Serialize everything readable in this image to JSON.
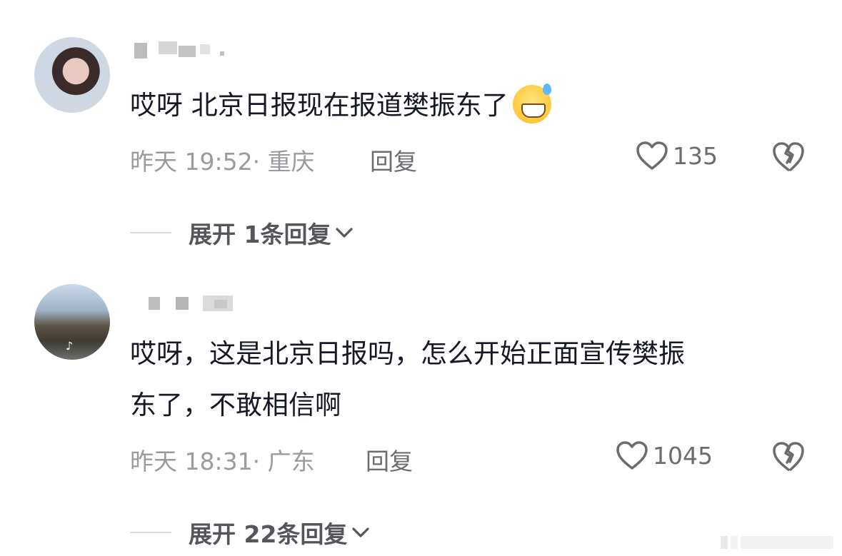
{
  "comments": [
    {
      "content_parts": [
        "哎呀 北京日报现在报道樊振东了"
      ],
      "emoji": "grinning-sweat-emoji",
      "time": "昨天 19:52",
      "location": "· 重庆",
      "reply_label": "回复",
      "likes": "135",
      "expand_label": "展开 1条回复"
    },
    {
      "content_line1": "哎呀，这是北京日报吗，怎么开始正面宣传樊振",
      "content_line2": "东了，不敢相信啊",
      "time": "昨天 18:31",
      "location": "· 广东",
      "reply_label": "回复",
      "likes": "1045",
      "expand_label": "展开 22条回复"
    }
  ],
  "colors": {
    "text": "#161823",
    "meta": "#9a9a9f",
    "secondary": "#6b6b70"
  }
}
